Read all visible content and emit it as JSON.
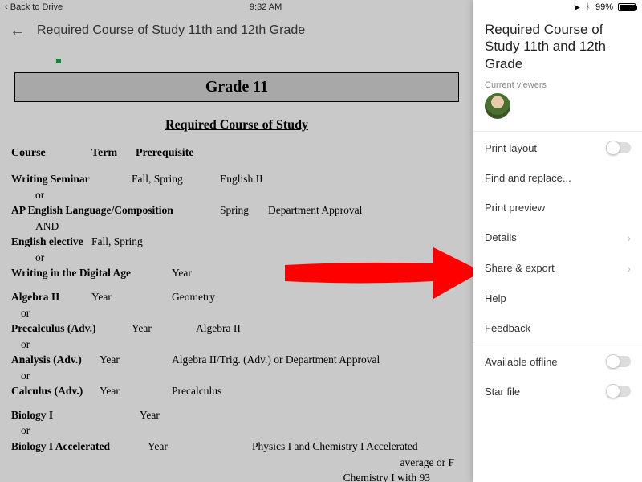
{
  "status_bar": {
    "back_label": "Back to Drive",
    "time": "9:32 AM",
    "battery_pct": "99%"
  },
  "nav": {
    "title": "Required Course of Study 11th and 12th Grade"
  },
  "doc": {
    "banner": "Grade 11",
    "subtitle": "Required Course of Study",
    "headers": {
      "course": "Course",
      "term": "Term",
      "prereq": "Prerequisite"
    },
    "rows": {
      "writing_seminar": {
        "course": "Writing Seminar",
        "or": "or",
        "term": "Fall, Spring",
        "pre": "English II"
      },
      "ap_english": {
        "course": "AP English Language/Composition",
        "and": "AND",
        "term": "Spring",
        "pre": "Department Approval"
      },
      "english_elective": {
        "course": "English elective",
        "or": "or",
        "term": "Fall, Spring"
      },
      "writing_digital": {
        "course": "Writing in the Digital Age",
        "term": "Year"
      },
      "algebra2": {
        "course": "Algebra II",
        "or": "or",
        "term": "Year",
        "pre": "Geometry"
      },
      "precalc_adv": {
        "course": "Precalculus (Adv.)",
        "or": "or",
        "term": "Year",
        "pre": "Algebra II"
      },
      "analysis_adv": {
        "course": "Analysis (Adv.)",
        "or": "or",
        "term": "Year",
        "pre": "Algebra II/Trig. (Adv.) or Department Approval"
      },
      "calculus_adv": {
        "course": "Calculus (Adv.)",
        "term": "Year",
        "pre": "Precalculus"
      },
      "biology1": {
        "course": "Biology I",
        "or": "or",
        "term": "Year"
      },
      "biology1_acc": {
        "course": "Biology I Accelerated",
        "term": "Year",
        "pre1": "Physics I and Chemistry I Accelerated",
        "pre2": "average or F",
        "pre3": "Chemistry I with 93"
      }
    }
  },
  "panel": {
    "title": "Required Course of Study 11th and 12th Grade",
    "viewers_label": "Current viewers",
    "menu": {
      "print_layout": "Print layout",
      "find_replace": "Find and replace...",
      "print_preview": "Print preview",
      "details": "Details",
      "share_export": "Share & export",
      "help": "Help",
      "feedback": "Feedback",
      "available_offline": "Available offline",
      "star_file": "Star file"
    }
  }
}
